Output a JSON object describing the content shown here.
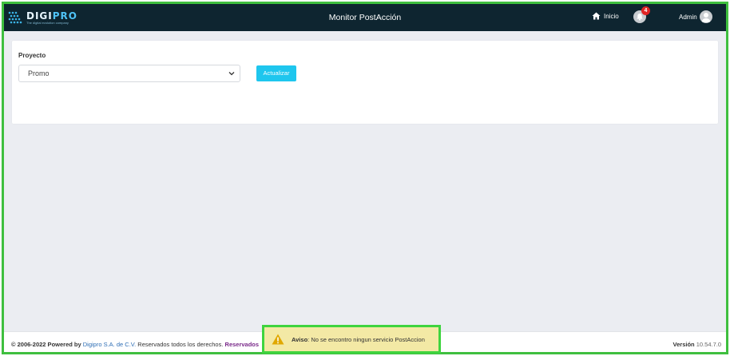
{
  "header": {
    "logo_name_prefix": "DIGI",
    "logo_name_accent": "PRO",
    "logo_tagline": "The digital evolution company",
    "title": "Monitor PostAcción",
    "home_label": "Inicio",
    "notification_count": "4",
    "user_label": "Admin"
  },
  "form": {
    "project_label": "Proyecto",
    "project_value": "Promo",
    "update_button": "Actualizar"
  },
  "footer": {
    "copyright": "© 2006-2022 Powered by",
    "company_link": "Digipro S.A. de C.V.",
    "rights": "Reservados todos los derechos.",
    "truncated_link": "Reservados",
    "version_label": "Versión",
    "version_value": "10.54.7.0"
  },
  "toast": {
    "title": "Aviso",
    "message": ": No se encontro ningun servicio PostAccion"
  },
  "colors": {
    "topbar": "#0e2530",
    "accent": "#1ec6ee",
    "badge": "#e02424",
    "toast_bg": "#f3e9a5",
    "highlight": "#3fbf3f"
  },
  "icons": {
    "home": "home-icon",
    "bell": "bell-icon",
    "avatar": "user-avatar-icon",
    "chevron": "chevron-down-icon",
    "warning": "warning-icon"
  }
}
